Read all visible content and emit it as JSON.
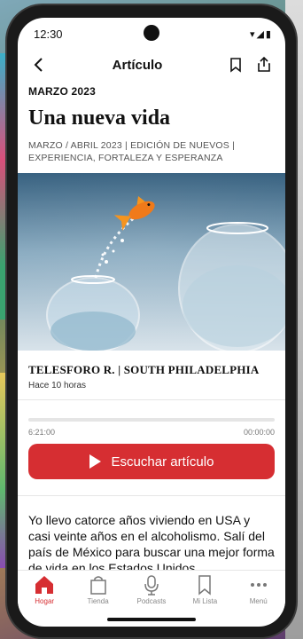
{
  "status": {
    "time": "12:30",
    "icons": "▾◢▮"
  },
  "nav": {
    "title": "Artículo"
  },
  "article": {
    "kicker": "MARZO 2023",
    "title": "Una nueva vida",
    "meta": "MARZO / ABRIL 2023 | EDICIÓN DE NUEVOS | EXPERIENCIA, FORTALEZA Y ESPERANZA",
    "author": "TELESFORO R. | SOUTH PHILADELPHIA",
    "time_ago": "Hace 10 horas",
    "body": "Yo llevo catorce años viviendo en USA y casi veinte años en el alcoholismo. Salí del país de México para buscar una mejor forma de vida en los Estados Unidos."
  },
  "player": {
    "elapsed": "6:21:00",
    "remaining": "00:00:00",
    "progress": 0,
    "button_label": "Escuchar artículo"
  },
  "tabs": [
    {
      "label": "Hogar",
      "icon": "home-icon",
      "active": true
    },
    {
      "label": "Tienda",
      "icon": "shopping-bag-icon",
      "active": false
    },
    {
      "label": "Podcasts",
      "icon": "microphone-icon",
      "active": false
    },
    {
      "label": "Mi Lista",
      "icon": "bookmark-icon",
      "active": false
    },
    {
      "label": "Menú",
      "icon": "more-icon",
      "active": false
    }
  ],
  "colors": {
    "accent": "#d62e32"
  }
}
